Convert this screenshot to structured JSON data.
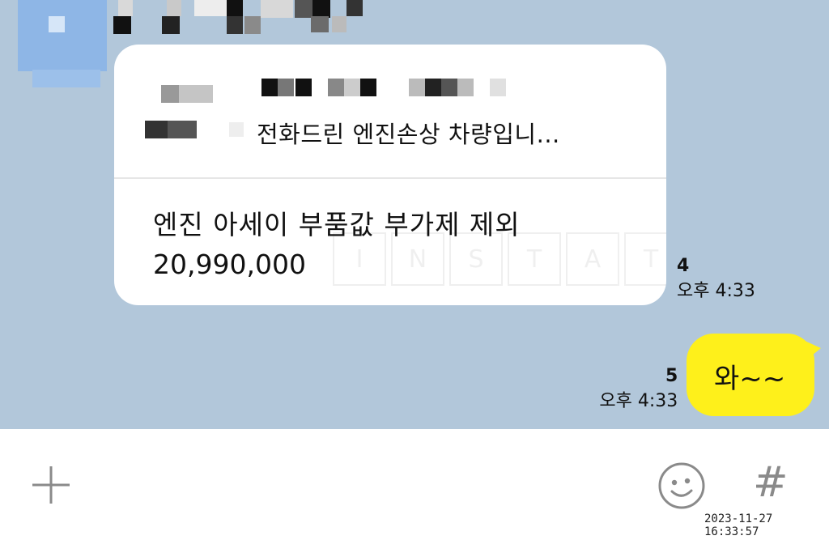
{
  "card": {
    "preview_text": "전화드린 엔진손상 차량입니...",
    "title": "엔진 아세이 부품값 부가제 제외",
    "price": "20,990,000",
    "watermark_letters": [
      "I",
      "N",
      "S",
      "T",
      "A",
      "T"
    ]
  },
  "received_meta": {
    "unread_count": "4",
    "time": "오후 4:33"
  },
  "sent_message": {
    "text": "와~~",
    "unread_count": "5",
    "time": "오후 4:33"
  },
  "input_bar": {
    "icons": [
      "plus-icon",
      "emoji-icon",
      "hash-icon"
    ],
    "hash_glyph": "#"
  },
  "capture_timestamp": "2023-11-27 16:33:57",
  "colors": {
    "chat_background": "#b2c7da",
    "sent_bubble": "#fef01b",
    "received_bubble": "#ffffff"
  }
}
